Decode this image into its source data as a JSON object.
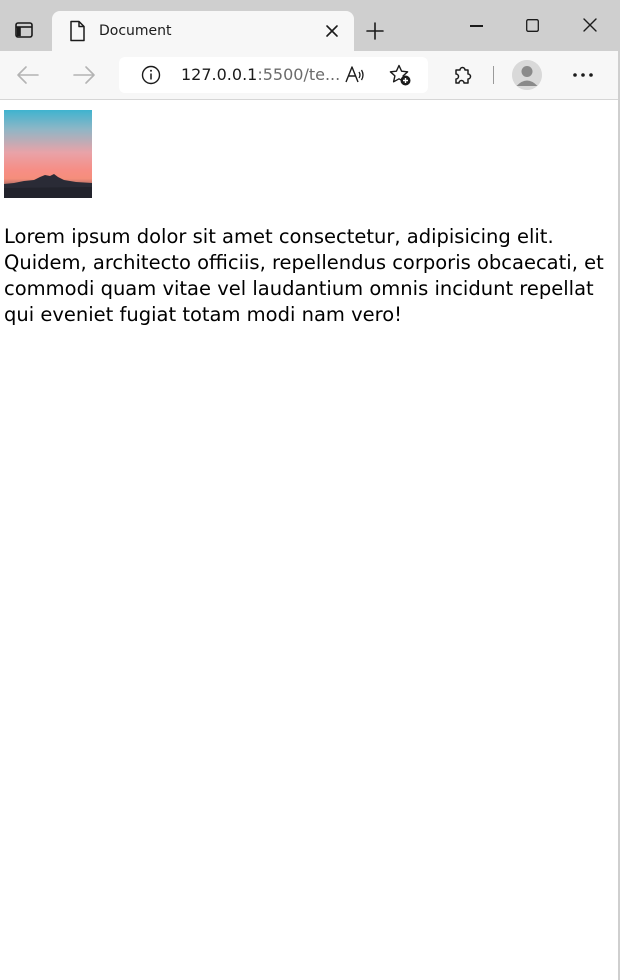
{
  "tab": {
    "title": "Document"
  },
  "toolbar": {
    "url_host": "127.0.0.1",
    "url_rest": ":5500/te..."
  },
  "content": {
    "paragraph": "Lorem ipsum dolor sit amet consectetur, adipisicing elit. Quidem, architecto officiis, repellendus corporis obcaecati, et commodi quam vitae vel laudantium omnis incidunt repellat qui eveniet fugiat totam modi nam vero!"
  },
  "icons": {
    "sidebar": "sidebar-toggle-icon",
    "page": "document-icon",
    "close_tab": "close-icon",
    "new_tab": "plus-icon",
    "back": "arrow-left-icon",
    "forward": "arrow-right-icon",
    "info": "info-icon",
    "read_aloud": "read-aloud-icon",
    "favorites": "star-plus-icon",
    "extensions": "puzzle-icon",
    "profile": "avatar-icon",
    "more": "ellipsis-icon"
  }
}
